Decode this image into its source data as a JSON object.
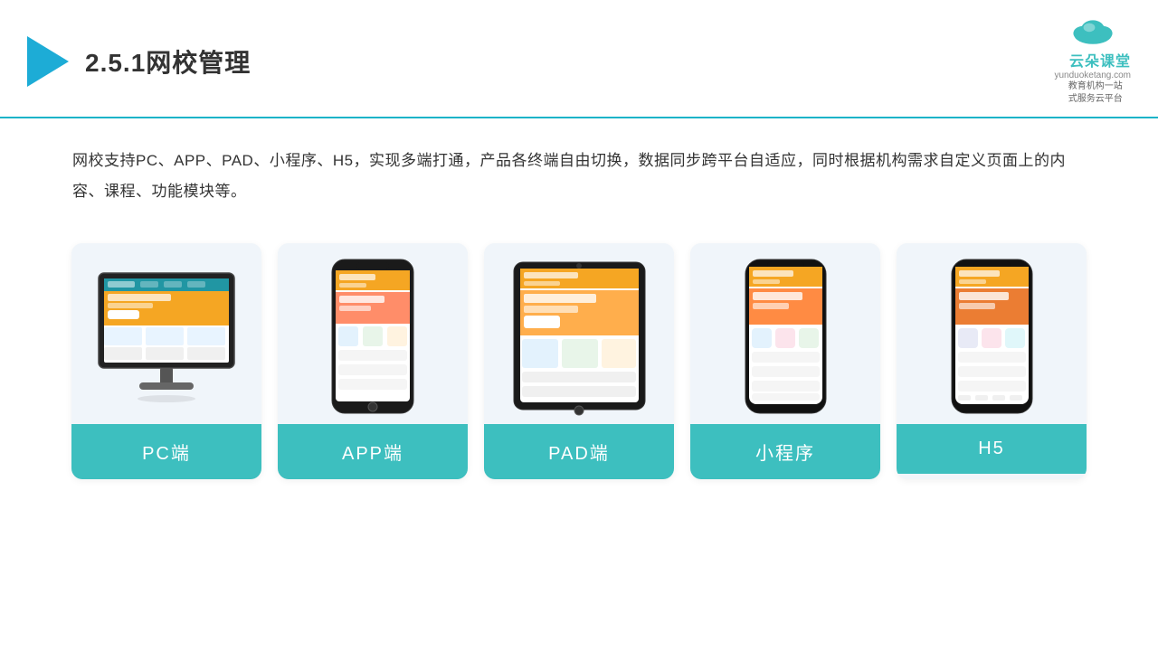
{
  "header": {
    "title": "2.5.1网校管理",
    "brand": {
      "name": "云朵课堂",
      "domain": "yunduoketang.com",
      "slogan_line1": "教育机构一站",
      "slogan_line2": "式服务云平台"
    }
  },
  "description": "网校支持PC、APP、PAD、小程序、H5，实现多端打通，产品各终端自由切换，数据同步跨平台自适应，同时根据机构需求自定义页面上的内容、课程、功能模块等。",
  "cards": [
    {
      "id": "pc",
      "label": "PC端"
    },
    {
      "id": "app",
      "label": "APP端"
    },
    {
      "id": "pad",
      "label": "PAD端"
    },
    {
      "id": "miniapp",
      "label": "小程序"
    },
    {
      "id": "h5",
      "label": "H5"
    }
  ],
  "colors": {
    "accent": "#1ab3c8",
    "card_bg": "#f0f5fa",
    "card_label_bg": "#3dbfbf",
    "card_label_text": "#ffffff"
  }
}
